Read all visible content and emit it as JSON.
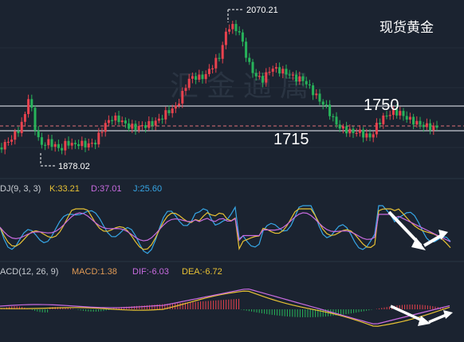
{
  "instrument": {
    "title": "现货黄金"
  },
  "price_panel": {
    "high_label": "2070.21",
    "low_label": "1878.02",
    "level_upper": "1750",
    "level_lower": "1715",
    "watermark": "汇 金 通 属"
  },
  "kdj_panel": {
    "name": "DJ(9, 3, 3)",
    "k_text": "K:33.21",
    "d_text": "D:37.01",
    "j_text": "J:25.60",
    "colors": {
      "k": "#e8c234",
      "d": "#c86be0",
      "j": "#36a6e6"
    }
  },
  "macd_panel": {
    "name": "ACD(12, 26, 9)",
    "macd_text": "MACD:1.38",
    "dif_text": "DIF:-6.03",
    "dea_text": "DEA:-6.72",
    "colors": {
      "macd": "#e09a55",
      "dif": "#c86be0",
      "dea": "#e8c234"
    }
  },
  "colors": {
    "background": "#1b2330",
    "up": "#e8424e",
    "down": "#27b35a",
    "level_line": "#c8ccd2",
    "dashed_line": "#e07078",
    "text": "#ffffff"
  },
  "chart_data": {
    "type": "candlestick",
    "title": "现货黄金",
    "annotations": [
      "2070.21",
      "1878.02",
      "1750",
      "1715"
    ],
    "series": [
      {
        "name": "K",
        "value": 33.21
      },
      {
        "name": "D",
        "value": 37.01
      },
      {
        "name": "J",
        "value": 25.6
      },
      {
        "name": "MACD",
        "value": 1.38
      },
      {
        "name": "DIF",
        "value": -6.03
      },
      {
        "name": "DEA",
        "value": -6.72
      }
    ]
  }
}
